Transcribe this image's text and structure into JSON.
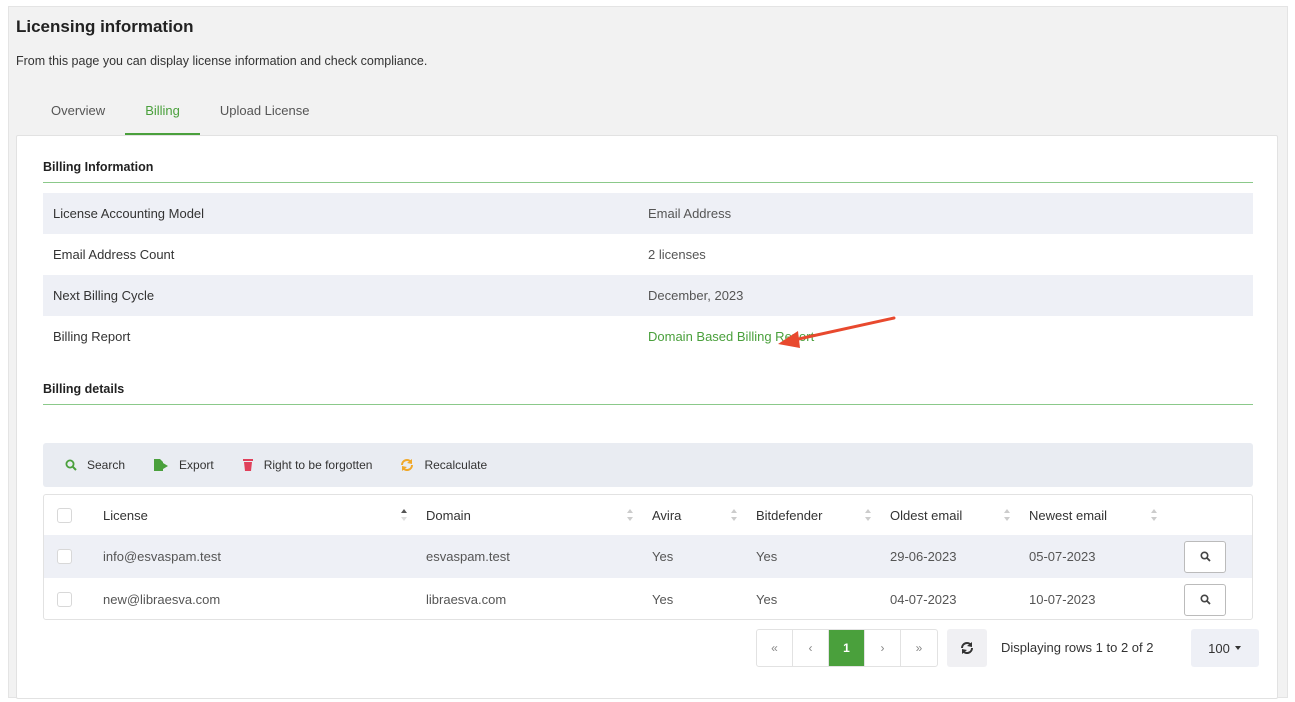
{
  "page": {
    "title": "Licensing information",
    "description": "From this page you can display license information and check compliance."
  },
  "tabs": [
    {
      "label": "Overview",
      "active": false
    },
    {
      "label": "Billing",
      "active": true
    },
    {
      "label": "Upload License",
      "active": false
    }
  ],
  "billing_info": {
    "title": "Billing Information",
    "rows": [
      {
        "label": "License Accounting Model",
        "value": "Email Address"
      },
      {
        "label": "Email Address Count",
        "value": "2 licenses"
      },
      {
        "label": "Next Billing Cycle",
        "value": "December, 2023"
      },
      {
        "label": "Billing Report",
        "value": "Domain Based Billing Report"
      }
    ]
  },
  "billing_details": {
    "title": "Billing details",
    "toolbar": {
      "search": "Search",
      "export": "Export",
      "forget": "Right to be forgotten",
      "recalculate": "Recalculate"
    },
    "columns": [
      "License",
      "Domain",
      "Avira",
      "Bitdefender",
      "Oldest email",
      "Newest email"
    ],
    "rows": [
      {
        "license": "info@esvaspam.test",
        "domain": "esvaspam.test",
        "avira": "Yes",
        "bitdefender": "Yes",
        "oldest": "29-06-2023",
        "newest": "05-07-2023"
      },
      {
        "license": "new@libraesva.com",
        "domain": "libraesva.com",
        "avira": "Yes",
        "bitdefender": "Yes",
        "oldest": "04-07-2023",
        "newest": "10-07-2023"
      }
    ]
  },
  "pagination": {
    "first": "«",
    "prev": "‹",
    "current": "1",
    "next": "›",
    "last": "»",
    "rows_info": "Displaying rows 1 to 2 of 2",
    "page_size": "100"
  },
  "colors": {
    "accent": "#4aa03c",
    "arrow": "#e8492e",
    "row_shade": "#eef0f6"
  }
}
